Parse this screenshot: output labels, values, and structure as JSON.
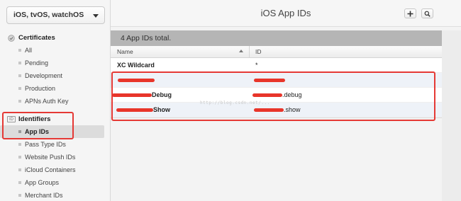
{
  "sidebar": {
    "platform_select": "iOS, tvOS, watchOS",
    "certificates": {
      "title": "Certificates",
      "items": [
        "All",
        "Pending",
        "Development",
        "Production",
        "APNs Auth Key"
      ]
    },
    "identifiers": {
      "title": "Identifiers",
      "icon_text": "ID",
      "items": [
        "App IDs",
        "Pass Type IDs",
        "Website Push IDs",
        "iCloud Containers",
        "App Groups",
        "Merchant IDs"
      ],
      "selected": "App IDs"
    }
  },
  "main": {
    "title": "iOS App IDs",
    "summary": "4  App IDs total.",
    "columns": {
      "name": "Name",
      "id": "ID"
    },
    "rows": [
      {
        "name": "XC Wildcard",
        "id": "*"
      },
      {
        "name": "",
        "id": ""
      },
      {
        "name": "Debug",
        "id": ".debug"
      },
      {
        "name": "Show",
        "id": ".show"
      }
    ],
    "watermark": "http://blog.csdn.net/..."
  },
  "icons": {
    "certificates": "certificate-icon",
    "identifiers": "id-icon",
    "add": "plus-icon",
    "search": "search-icon"
  },
  "colors": {
    "annotation_red": "#e53935",
    "redaction_red": "#e8352a",
    "summary_bar": "#b5b5b5",
    "selected_item": "#dcdcdc"
  }
}
